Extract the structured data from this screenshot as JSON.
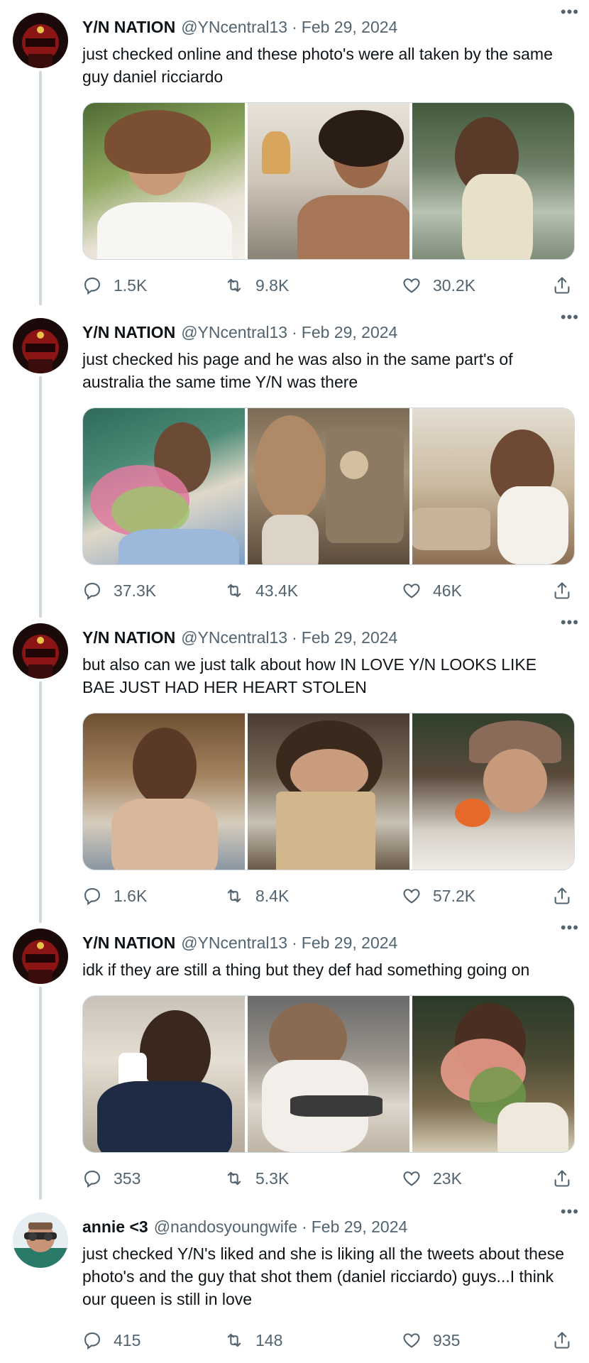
{
  "tweets": [
    {
      "name": "Y/N NATION",
      "handle": "@YNcentral13",
      "date": "Feb 29, 2024",
      "text": "just checked online and these photo's were all taken by the same guy daniel ricciardo",
      "replies": "1.5K",
      "retweets": "9.8K",
      "likes": "30.2K",
      "avatar": "red-helmet"
    },
    {
      "name": "Y/N NATION",
      "handle": "@YNcentral13",
      "date": "Feb 29, 2024",
      "text": "just checked his page and he was also in the same part's of australia the same time Y/N was there",
      "replies": "37.3K",
      "retweets": "43.4K",
      "likes": "46K",
      "avatar": "red-helmet"
    },
    {
      "name": "Y/N NATION",
      "handle": "@YNcentral13",
      "date": "Feb 29, 2024",
      "text": "but also can we just talk about how IN LOVE Y/N LOOKS LIKE BAE JUST HAD HER HEART STOLEN",
      "replies": "1.6K",
      "retweets": "8.4K",
      "likes": "57.2K",
      "avatar": "red-helmet"
    },
    {
      "name": "Y/N NATION",
      "handle": "@YNcentral13",
      "date": "Feb 29, 2024",
      "text": "idk if they are still a thing but they def had something going on",
      "replies": "353",
      "retweets": "5.3K",
      "likes": "23K",
      "avatar": "red-helmet"
    },
    {
      "name": "annie <3",
      "handle": "@nandosyoungwife",
      "date": "Feb 29, 2024",
      "text": "just checked Y/N's liked and she is liking all the tweets about these photo's and the guy that shot them (daniel ricciardo) guys...I think our queen is still in love",
      "replies": "415",
      "retweets": "148",
      "likes": "935",
      "avatar": "driver-sunglasses"
    }
  ],
  "separator": "·",
  "icons": {
    "reply": "reply-icon",
    "retweet": "retweet-icon",
    "like": "heart-icon",
    "share": "share-icon",
    "more": "more-icon"
  },
  "colors": {
    "text": "#0f1419",
    "secondary": "#536471",
    "thread": "#cfd9de"
  }
}
